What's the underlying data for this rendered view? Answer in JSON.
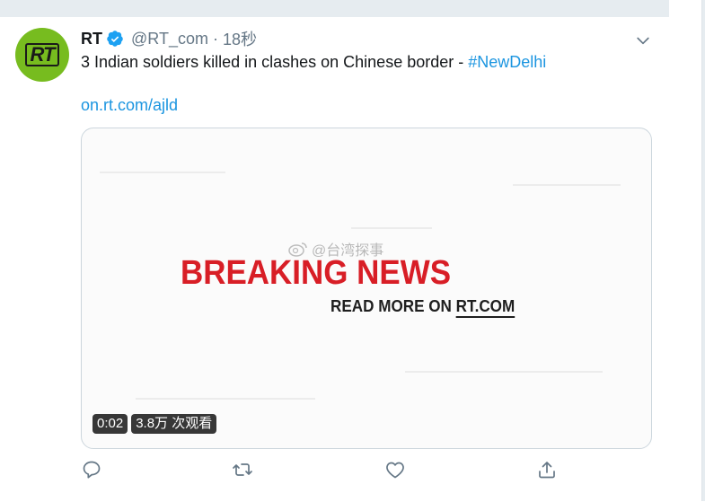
{
  "tweet": {
    "avatar_text": "RT",
    "name": "RT",
    "handle": "@RT_com",
    "separator": "·",
    "time": "18秒",
    "text": "3 Indian soldiers killed in clashes on Chinese border - ",
    "hashtag": "#NewDelhi",
    "link": "on.rt.com/ajld"
  },
  "media": {
    "headline": "BREAKING NEWS",
    "subline_prefix": "READ MORE ON ",
    "subline_site": "RT.COM",
    "watermark": "@台湾探事",
    "duration": "0:02",
    "views": "3.8万 次观看"
  },
  "colors": {
    "accent": "#1b95e0",
    "avatar_bg": "#77bc1f",
    "breaking_red": "#d81e26",
    "muted": "#657786"
  },
  "icons": {
    "verified": "verified-badge-icon",
    "menu": "chevron-down-icon",
    "reply": "reply-icon",
    "retweet": "retweet-icon",
    "like": "heart-icon",
    "share": "share-icon"
  }
}
